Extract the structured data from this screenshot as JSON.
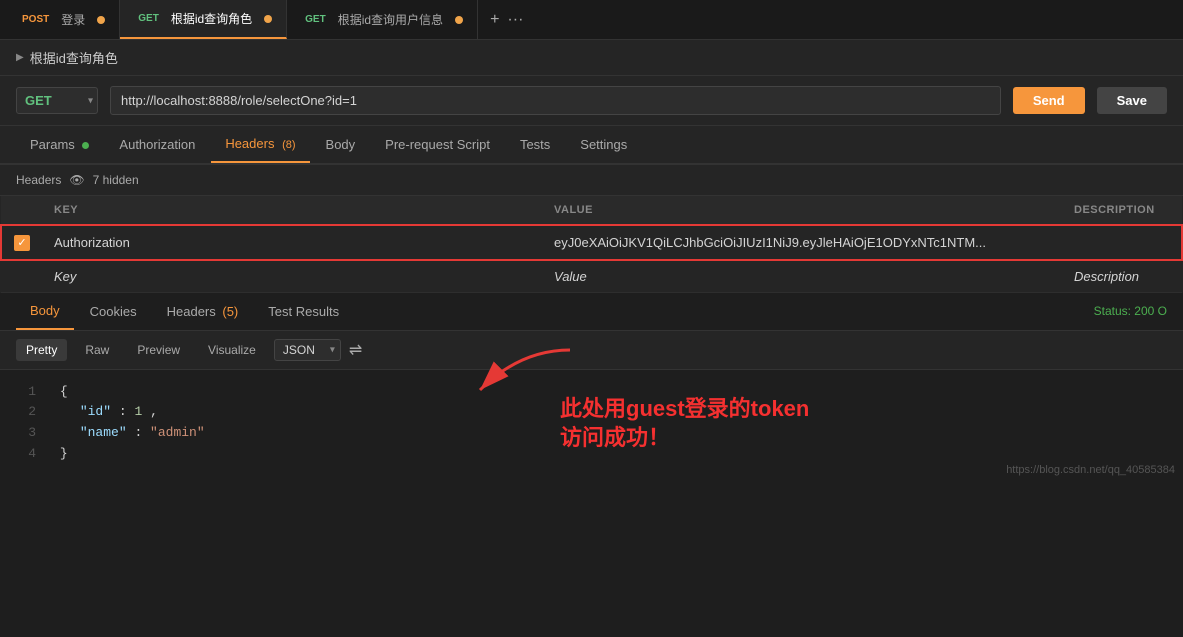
{
  "tabs": [
    {
      "method": "POST",
      "method_class": "post",
      "label": "登录",
      "active": false,
      "has_dot": true
    },
    {
      "method": "GET",
      "method_class": "get",
      "label": "根据id查询角色",
      "active": true,
      "has_dot": true
    },
    {
      "method": "GET",
      "method_class": "get",
      "label": "根据id查询用户信息",
      "active": false,
      "has_dot": true
    }
  ],
  "tab_actions": {
    "add": "+",
    "more": "···"
  },
  "breadcrumb": {
    "arrow": "▶",
    "label": "根据id查询角色"
  },
  "request": {
    "method": "GET",
    "url": "http://localhost:8888/role/selectOne?id=1",
    "send_label": "Send",
    "save_label": "Save"
  },
  "sub_tabs": [
    {
      "label": "Params",
      "has_dot": true,
      "active": false
    },
    {
      "label": "Authorization",
      "active": false
    },
    {
      "label": "Headers",
      "badge": "(8)",
      "active": true
    },
    {
      "label": "Body",
      "active": false
    },
    {
      "label": "Pre-request Script",
      "active": false
    },
    {
      "label": "Tests",
      "active": false
    },
    {
      "label": "Settings",
      "active": false
    }
  ],
  "headers_info": {
    "label": "Headers",
    "hidden_count": "7 hidden"
  },
  "table": {
    "columns": [
      "KEY",
      "VALUE",
      "DESCRIPTION"
    ],
    "rows": [
      {
        "checked": true,
        "key": "Authorization",
        "value": "eyJ0eXAiOiJKV1QiLCJhbGciOiJIUzI1NiJ9.eyJleHAiOjE1ODYxNTc1NTM...",
        "description": ""
      }
    ],
    "empty_row": {
      "key": "Key",
      "value": "Value",
      "description": "Description"
    }
  },
  "annotation": {
    "text": "此处用guest登录的token\n访问成功！"
  },
  "response_tabs": [
    {
      "label": "Body",
      "active": true
    },
    {
      "label": "Cookies",
      "active": false
    },
    {
      "label": "Headers",
      "badge": "(5)",
      "active": false
    },
    {
      "label": "Test Results",
      "active": false
    }
  ],
  "status": "Status: 200 O",
  "format_buttons": [
    "Pretty",
    "Raw",
    "Preview",
    "Visualize"
  ],
  "active_format": "Pretty",
  "format_type": "JSON",
  "code": [
    {
      "line": 1,
      "content": "{"
    },
    {
      "line": 2,
      "content": "    \"id\": 1,"
    },
    {
      "line": 3,
      "content": "    \"name\": \"admin\""
    },
    {
      "line": 4,
      "content": "}"
    }
  ],
  "watermark": "https://blog.csdn.net/qq_40585384"
}
